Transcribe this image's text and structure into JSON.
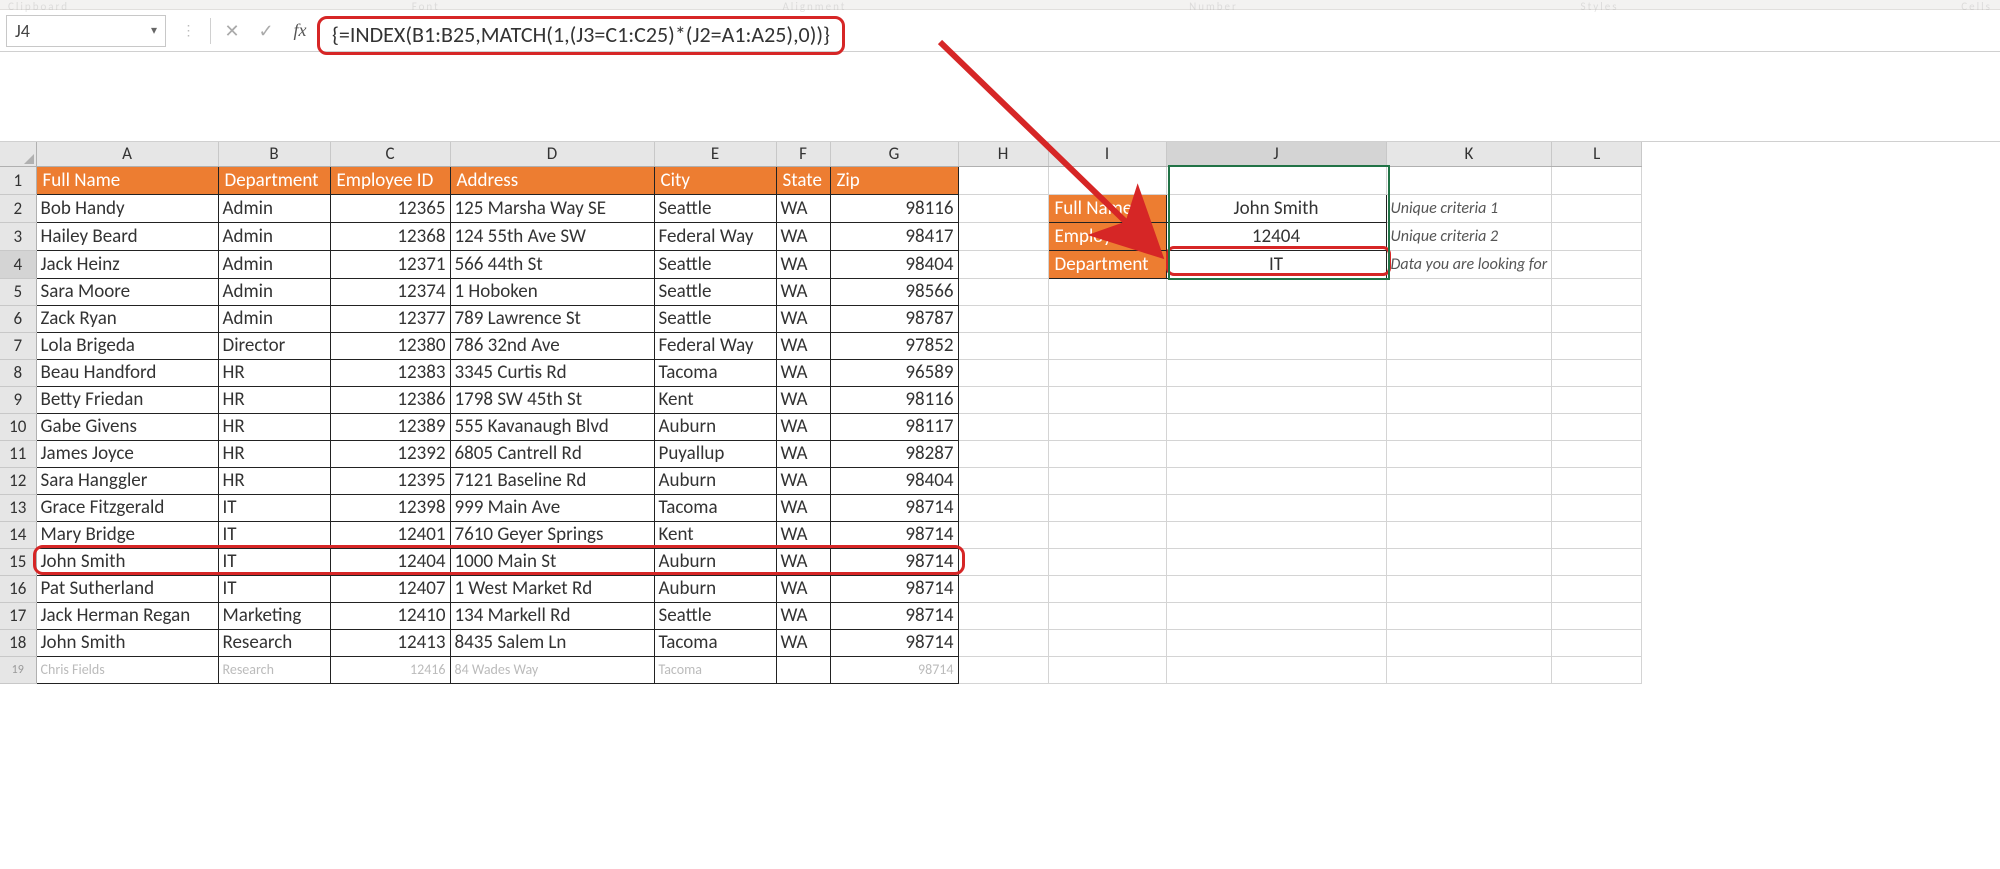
{
  "name_box": "J4",
  "formula": "{=INDEX(B1:B25,MATCH(1,(J3=C1:C25)*(J2=A1:A25),0))}",
  "fx_label": "fx",
  "ribbon": {
    "clipboard": "Clipboard",
    "font": "Font",
    "alignment": "Alignment",
    "number": "Number",
    "styles": "Styles",
    "cells": "Cells"
  },
  "columns": [
    "A",
    "B",
    "C",
    "D",
    "E",
    "F",
    "G",
    "H",
    "I",
    "J",
    "K",
    "L"
  ],
  "headers": {
    "A": "Full Name",
    "B": "Department",
    "C": "Employee ID",
    "D": "Address",
    "E": "City",
    "F": "State",
    "G": "Zip"
  },
  "rows": [
    {
      "n": 2,
      "A": "Bob Handy",
      "B": "Admin",
      "C": "12365",
      "D": "125 Marsha Way SE",
      "E": "Seattle",
      "F": "WA",
      "G": "98116"
    },
    {
      "n": 3,
      "A": "Hailey Beard",
      "B": "Admin",
      "C": "12368",
      "D": "124 55th Ave SW",
      "E": "Federal Way",
      "F": "WA",
      "G": "98417"
    },
    {
      "n": 4,
      "A": "Jack Heinz",
      "B": "Admin",
      "C": "12371",
      "D": "566 44th St",
      "E": "Seattle",
      "F": "WA",
      "G": "98404"
    },
    {
      "n": 5,
      "A": "Sara Moore",
      "B": "Admin",
      "C": "12374",
      "D": "1 Hoboken",
      "E": "Seattle",
      "F": "WA",
      "G": "98566"
    },
    {
      "n": 6,
      "A": "Zack Ryan",
      "B": "Admin",
      "C": "12377",
      "D": "789 Lawrence St",
      "E": "Seattle",
      "F": "WA",
      "G": "98787"
    },
    {
      "n": 7,
      "A": "Lola Brigeda",
      "B": "Director",
      "C": "12380",
      "D": "786 32nd Ave",
      "E": "Federal Way",
      "F": "WA",
      "G": "97852"
    },
    {
      "n": 8,
      "A": "Beau Handford",
      "B": "HR",
      "C": "12383",
      "D": "3345 Curtis Rd",
      "E": "Tacoma",
      "F": "WA",
      "G": "96589"
    },
    {
      "n": 9,
      "A": "Betty Friedan",
      "B": "HR",
      "C": "12386",
      "D": "1798 SW 45th St",
      "E": "Kent",
      "F": "WA",
      "G": "98116"
    },
    {
      "n": 10,
      "A": "Gabe Givens",
      "B": "HR",
      "C": "12389",
      "D": "555 Kavanaugh Blvd",
      "E": "Auburn",
      "F": "WA",
      "G": "98117"
    },
    {
      "n": 11,
      "A": "James Joyce",
      "B": "HR",
      "C": "12392",
      "D": "6805 Cantrell Rd",
      "E": "Puyallup",
      "F": "WA",
      "G": "98287"
    },
    {
      "n": 12,
      "A": "Sara Hanggler",
      "B": "HR",
      "C": "12395",
      "D": "7121 Baseline Rd",
      "E": "Auburn",
      "F": "WA",
      "G": "98404"
    },
    {
      "n": 13,
      "A": "Grace Fitzgerald",
      "B": "IT",
      "C": "12398",
      "D": "999 Main Ave",
      "E": "Tacoma",
      "F": "WA",
      "G": "98714"
    },
    {
      "n": 14,
      "A": "Mary Bridge",
      "B": "IT",
      "C": "12401",
      "D": "7610 Geyer Springs",
      "E": "Kent",
      "F": "WA",
      "G": "98714"
    },
    {
      "n": 15,
      "A": "John Smith",
      "B": "IT",
      "C": "12404",
      "D": "1000 Main St",
      "E": "Auburn",
      "F": "WA",
      "G": "98714"
    },
    {
      "n": 16,
      "A": "Pat Sutherland",
      "B": "IT",
      "C": "12407",
      "D": "1 West Market Rd",
      "E": "Auburn",
      "F": "WA",
      "G": "98714"
    },
    {
      "n": 17,
      "A": "Jack Herman Regan",
      "B": "Marketing",
      "C": "12410",
      "D": "134 Markell Rd",
      "E": "Seattle",
      "F": "WA",
      "G": "98714"
    },
    {
      "n": 18,
      "A": "John Smith",
      "B": "Research",
      "C": "12413",
      "D": "8435 Salem Ln",
      "E": "Tacoma",
      "F": "WA",
      "G": "98714"
    }
  ],
  "partial_row": {
    "n": 19,
    "A": "Chris Fields",
    "B": "Research",
    "C": "12416",
    "D": "84 Wades Way",
    "E": "Tacoma",
    "G": "98714"
  },
  "lookup": {
    "labels": {
      "fullname": "Full Name",
      "empid": "Employee ID",
      "dept": "Department"
    },
    "values": {
      "fullname": "John Smith",
      "empid": "12404",
      "dept": "IT"
    },
    "notes": {
      "c1": "Unique criteria 1",
      "c2": "Unique criteria 2",
      "out": "Data you are looking for"
    }
  }
}
